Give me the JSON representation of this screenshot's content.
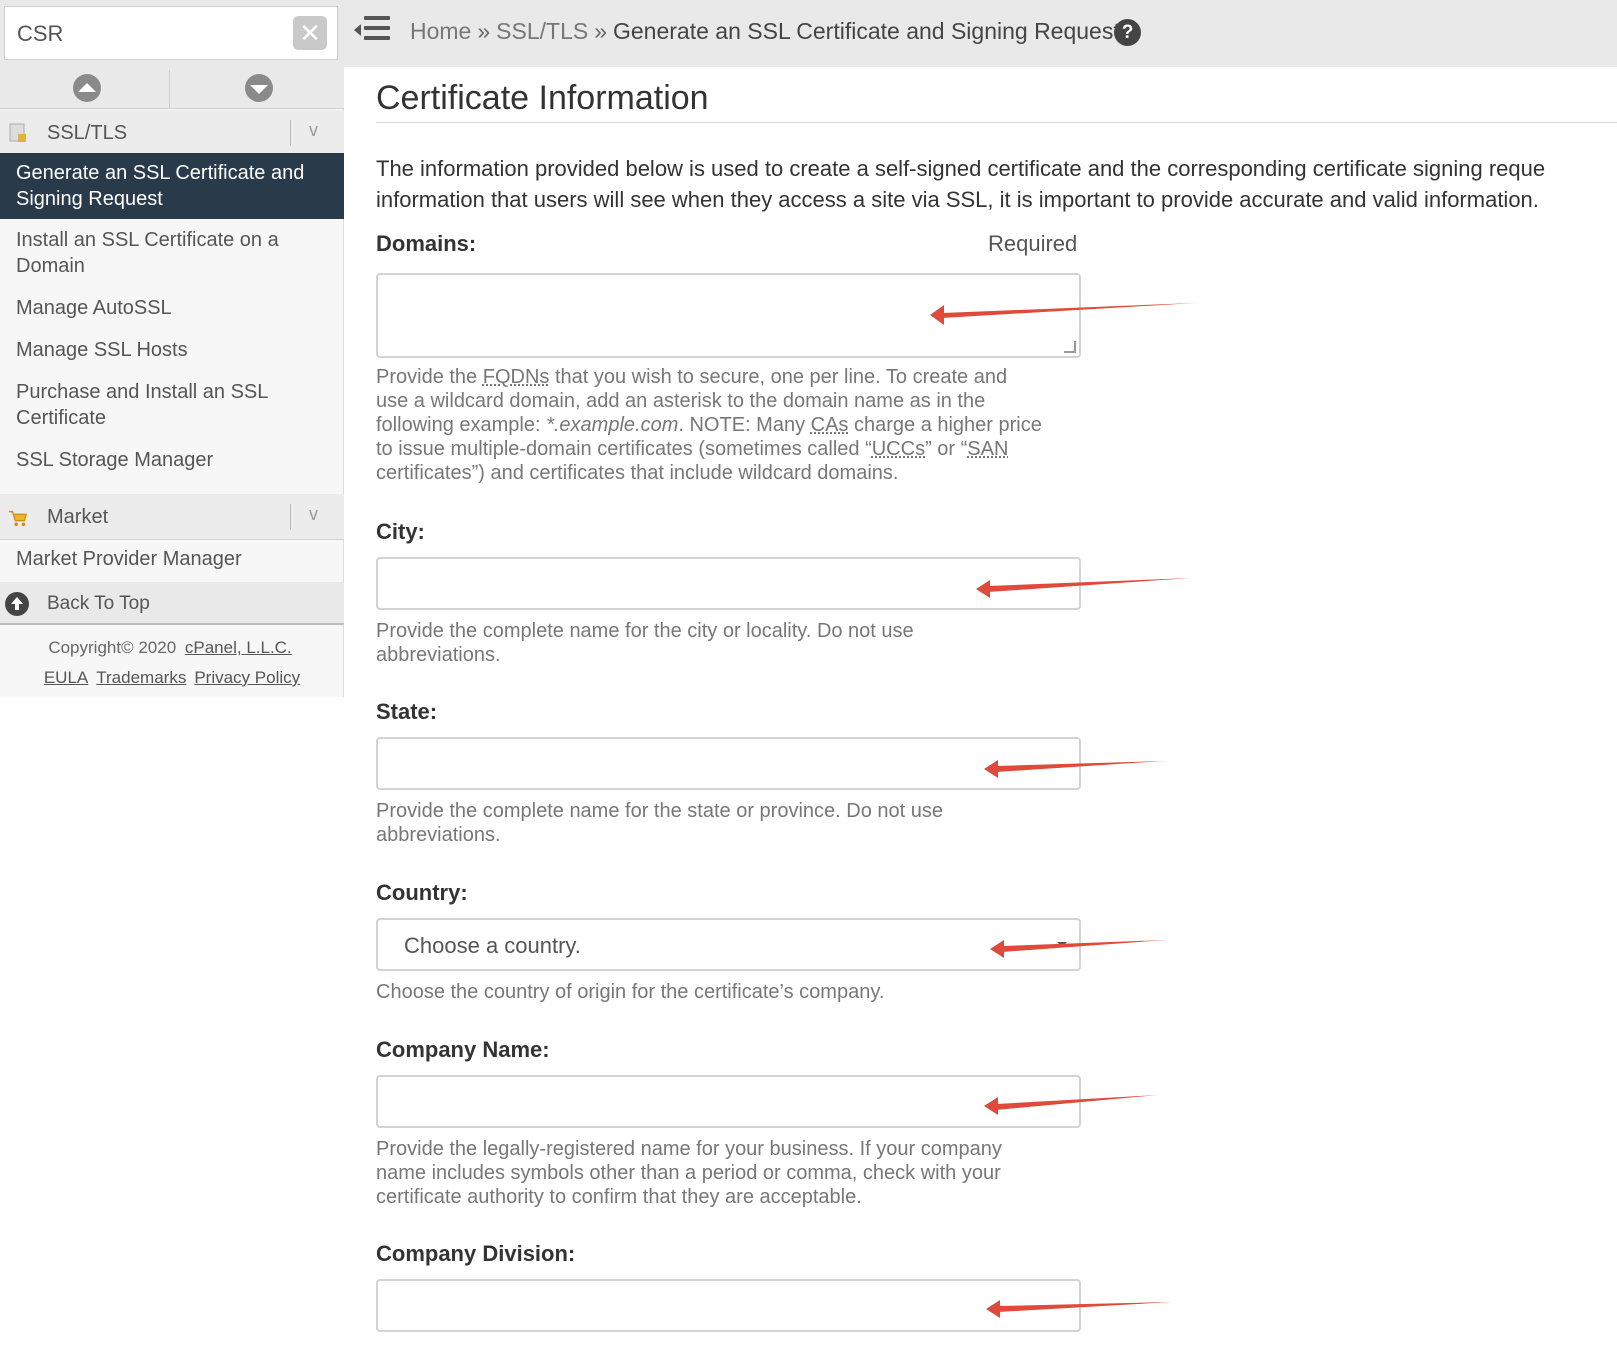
{
  "search": {
    "value": "CSR"
  },
  "breadcrumb": {
    "home": "Home",
    "sep": "»",
    "section": "SSL/TLS",
    "current": "Generate an SSL Certificate and Signing Request"
  },
  "sidebar": {
    "group_ssl": "SSL/TLS",
    "items": [
      {
        "label_line1": "Generate an SSL Certificate and",
        "label_line2": "Signing Request",
        "active": true
      },
      {
        "label_line1": "Install an SSL Certificate on a",
        "label_line2": "Domain"
      },
      {
        "label_line1": "Manage AutoSSL"
      },
      {
        "label_line1": "Manage SSL Hosts"
      },
      {
        "label_line1": "Purchase and Install an SSL",
        "label_line2": "Certificate"
      },
      {
        "label_line1": "SSL Storage Manager"
      }
    ],
    "group_market": "Market",
    "market_items": [
      {
        "label": "Market Provider Manager"
      }
    ],
    "back_to_top": "Back To Top",
    "chevron": "v"
  },
  "footer": {
    "copyright": "Copyright© 2020",
    "company": "cPanel, L.L.C.",
    "eula": "EULA",
    "trademarks": "Trademarks",
    "privacy": "Privacy Policy"
  },
  "main": {
    "title": "Certificate Information",
    "intro_line1": "The information provided below is used to create a self-signed certificate and the corresponding certificate signing reque",
    "intro_line2": "information that users will see when they access a site via SSL, it is important to provide accurate and valid information.",
    "required": "Required",
    "fields": {
      "domains": {
        "label": "Domains:",
        "help_l1a": "Provide the ",
        "help_l1b": "FQDNs",
        "help_l1c": " that you wish to secure, one per line. To create and",
        "help_l2": "use a wildcard domain, add an asterisk to the domain name as in the",
        "help_l3a": "following example: ",
        "help_l3b": "*.example.com",
        "help_l3c": ". NOTE: Many ",
        "help_l3d": "CAs",
        "help_l3e": " charge a higher price",
        "help_l4a": "to issue multiple-domain certificates (sometimes called “",
        "help_l4b": "UCCs",
        "help_l4c": "” or “",
        "help_l4d": "SAN",
        "help_l5": "certificates”) and certificates that include wildcard domains."
      },
      "city": {
        "label": "City:",
        "help_l1": "Provide the complete name for the city or locality. Do not use",
        "help_l2": "abbreviations."
      },
      "state": {
        "label": "State:",
        "help_l1": "Provide the complete name for the state or province. Do not use",
        "help_l2": "abbreviations."
      },
      "country": {
        "label": "Country:",
        "selected": "Choose a country.",
        "help": "Choose the country of origin for the certificate’s company."
      },
      "company": {
        "label": "Company Name:",
        "help_l1": "Provide the legally-registered name for your business. If your company",
        "help_l2": "name includes symbols other than a period or comma, check with your",
        "help_l3": "certificate authority to confirm that they are acceptable."
      },
      "division": {
        "label": "Company Division:"
      }
    }
  },
  "colors": {
    "active_nav": "#293a4a",
    "annotation_arrow": "#e04a3a"
  }
}
